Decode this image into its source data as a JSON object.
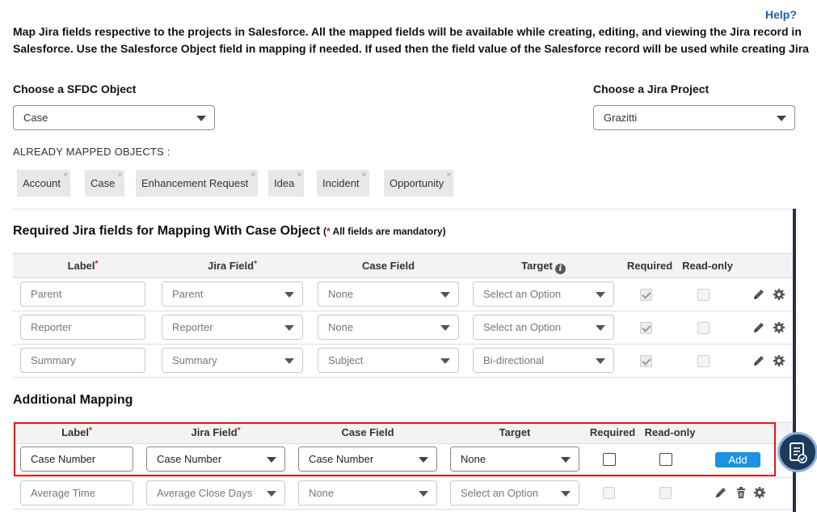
{
  "help_label": "Help?",
  "intro": {
    "line1": "Map Jira fields respective to the projects in Salesforce. All the mapped fields will be available while creating, editing, and viewing the Jira record in",
    "line2": "Salesforce. Use the Salesforce Object field in mapping if needed. If used then the field value of the Salesforce record will be used while creating Jira"
  },
  "sfdc_object": {
    "label": "Choose a SFDC Object",
    "value": "Case"
  },
  "jira_project": {
    "label": "Choose a Jira Project",
    "value": "Grazitti"
  },
  "already_mapped": {
    "label": "ALREADY MAPPED OBJECTS :",
    "chips": [
      "Account",
      "Case",
      "Enhancement Request",
      "Idea",
      "Incident",
      "Opportunity"
    ],
    "remove_glyph": "×"
  },
  "required_section": {
    "title": "Required Jira fields for Mapping With Case Object",
    "note_prefix": "(",
    "note_star": "*",
    "note_text": " All fields are mandatory)",
    "headers": {
      "label": "Label",
      "jira_field": "Jira Field",
      "case_field": "Case Field",
      "target": "Target",
      "required": "Required",
      "read_only": "Read-only"
    },
    "rows": [
      {
        "label": "Parent",
        "jira_field": "Parent",
        "case_field": "None",
        "target": "Select an Option",
        "required": true,
        "read_only": false
      },
      {
        "label": "Reporter",
        "jira_field": "Reporter",
        "case_field": "None",
        "target": "Select an Option",
        "required": true,
        "read_only": false
      },
      {
        "label": "Summary",
        "jira_field": "Summary",
        "case_field": "Subject",
        "target": "Bi-directional",
        "required": true,
        "read_only": false
      }
    ]
  },
  "additional_section": {
    "title": "Additional Mapping",
    "headers": {
      "label": "Label",
      "jira_field": "Jira Field",
      "case_field": "Case Field",
      "target": "Target",
      "required": "Required",
      "read_only": "Read-only"
    },
    "new_row": {
      "label": "Case Number",
      "jira_field": "Case Number",
      "case_field": "Case Number",
      "target": "None",
      "add_label": "Add"
    },
    "rows": [
      {
        "label": "Average Time",
        "jira_field": "Average Close Days",
        "case_field": "None",
        "target": "Select an Option",
        "required": false,
        "read_only": false
      }
    ]
  },
  "colors": {
    "accent": "#1c93e0",
    "highlight_border": "#e01b1b",
    "help_link": "#1a5fa8",
    "required_star": "#d11111"
  },
  "icons": [
    "edit-icon",
    "settings-icon",
    "delete-icon",
    "info-icon",
    "caret-down-icon",
    "document-check-icon"
  ]
}
